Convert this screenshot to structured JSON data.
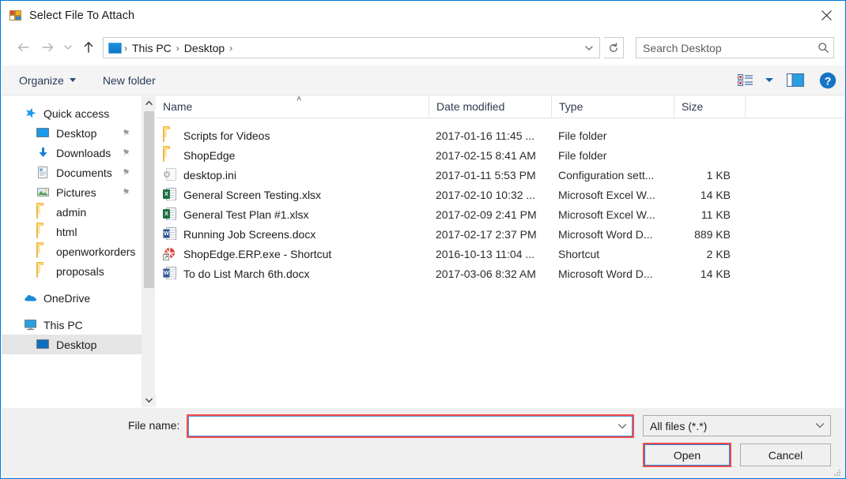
{
  "window": {
    "title": "Select File To Attach",
    "icon": "form-icon",
    "close_label": "✕"
  },
  "nav": {
    "back": "back-arrow",
    "forward": "forward-arrow",
    "recent": "recent-locations-chevron",
    "up": "up-arrow",
    "breadcrumbs": [
      "This PC",
      "Desktop"
    ],
    "separator": "›",
    "dropdown": "chevron-down-icon",
    "refresh": "refresh-icon"
  },
  "search": {
    "placeholder": "Search Desktop",
    "value": "",
    "icon": "search-icon"
  },
  "toolbar": {
    "organize_label": "Organize",
    "new_folder_label": "New folder",
    "view_icon": "view-list-icon",
    "view_caret": "chevron-down-icon",
    "preview_icon": "preview-pane-icon",
    "help_icon": "help-icon",
    "help_glyph": "?"
  },
  "sidebar": {
    "items": [
      {
        "label": "Quick access",
        "icon": "star-icon",
        "level": 0,
        "pinned": false,
        "selected": false
      },
      {
        "label": "Desktop",
        "icon": "monitor-icon",
        "level": 1,
        "pinned": true,
        "selected": false
      },
      {
        "label": "Downloads",
        "icon": "download-icon",
        "level": 1,
        "pinned": true,
        "selected": false
      },
      {
        "label": "Documents",
        "icon": "documents-icon",
        "level": 1,
        "pinned": true,
        "selected": false
      },
      {
        "label": "Pictures",
        "icon": "pictures-icon",
        "level": 1,
        "pinned": true,
        "selected": false
      },
      {
        "label": "admin",
        "icon": "folder-icon",
        "level": 1,
        "pinned": false,
        "selected": false
      },
      {
        "label": "html",
        "icon": "folder-icon",
        "level": 1,
        "pinned": false,
        "selected": false
      },
      {
        "label": "openworkorders",
        "icon": "folder-icon",
        "level": 1,
        "pinned": false,
        "selected": false
      },
      {
        "label": "proposals",
        "icon": "folder-icon",
        "level": 1,
        "pinned": false,
        "selected": false
      },
      {
        "label": "OneDrive",
        "icon": "cloud-icon",
        "level": 0,
        "pinned": false,
        "selected": false,
        "gap_before": true
      },
      {
        "label": "This PC",
        "icon": "computer-icon",
        "level": 0,
        "pinned": false,
        "selected": false,
        "gap_before": true
      },
      {
        "label": "Desktop",
        "icon": "monitor-icon",
        "level": 1,
        "pinned": false,
        "selected": true
      }
    ]
  },
  "filelist": {
    "columns": [
      {
        "label": "Name",
        "sorted": true,
        "sort_dir": "asc"
      },
      {
        "label": "Date modified",
        "sorted": false
      },
      {
        "label": "Type",
        "sorted": false
      },
      {
        "label": "Size",
        "sorted": false
      }
    ],
    "sort_caret": "˄",
    "rows": [
      {
        "name": "Scripts for Videos",
        "date": "2017-01-16 11:45 ...",
        "type": "File folder",
        "size": "",
        "icon": "folder-icon"
      },
      {
        "name": "ShopEdge",
        "date": "2017-02-15 8:41 AM",
        "type": "File folder",
        "size": "",
        "icon": "folder-icon"
      },
      {
        "name": "desktop.ini",
        "date": "2017-01-11 5:53 PM",
        "type": "Configuration sett...",
        "size": "1 KB",
        "icon": "ini-file-icon"
      },
      {
        "name": "General Screen Testing.xlsx",
        "date": "2017-02-10 10:32 ...",
        "type": "Microsoft Excel W...",
        "size": "14 KB",
        "icon": "excel-file-icon"
      },
      {
        "name": "General Test Plan #1.xlsx",
        "date": "2017-02-09 2:41 PM",
        "type": "Microsoft Excel W...",
        "size": "11 KB",
        "icon": "excel-file-icon"
      },
      {
        "name": "Running Job Screens.docx",
        "date": "2017-02-17 2:37 PM",
        "type": "Microsoft Word D...",
        "size": "889 KB",
        "icon": "word-file-icon"
      },
      {
        "name": "ShopEdge.ERP.exe - Shortcut",
        "date": "2016-10-13 11:04 ...",
        "type": "Shortcut",
        "size": "2 KB",
        "icon": "shortcut-icon"
      },
      {
        "name": "To do List March 6th.docx",
        "date": "2017-03-06 8:32 AM",
        "type": "Microsoft Word D...",
        "size": "14 KB",
        "icon": "word-file-icon"
      }
    ]
  },
  "footer": {
    "filename_label": "File name:",
    "filename_value": "",
    "filename_placeholder": "",
    "filter_value": "All files (*.*)",
    "open_label": "Open",
    "cancel_label": "Cancel"
  },
  "colors": {
    "accent": "#0078d7",
    "highlight_red": "#fc4a4a",
    "focus_blue": "#3f93d8",
    "folder_yellow": "#ffd666",
    "excel_green": "#1d6f42",
    "word_blue": "#2b579a",
    "chrome_gray": "#f0f0f0"
  }
}
